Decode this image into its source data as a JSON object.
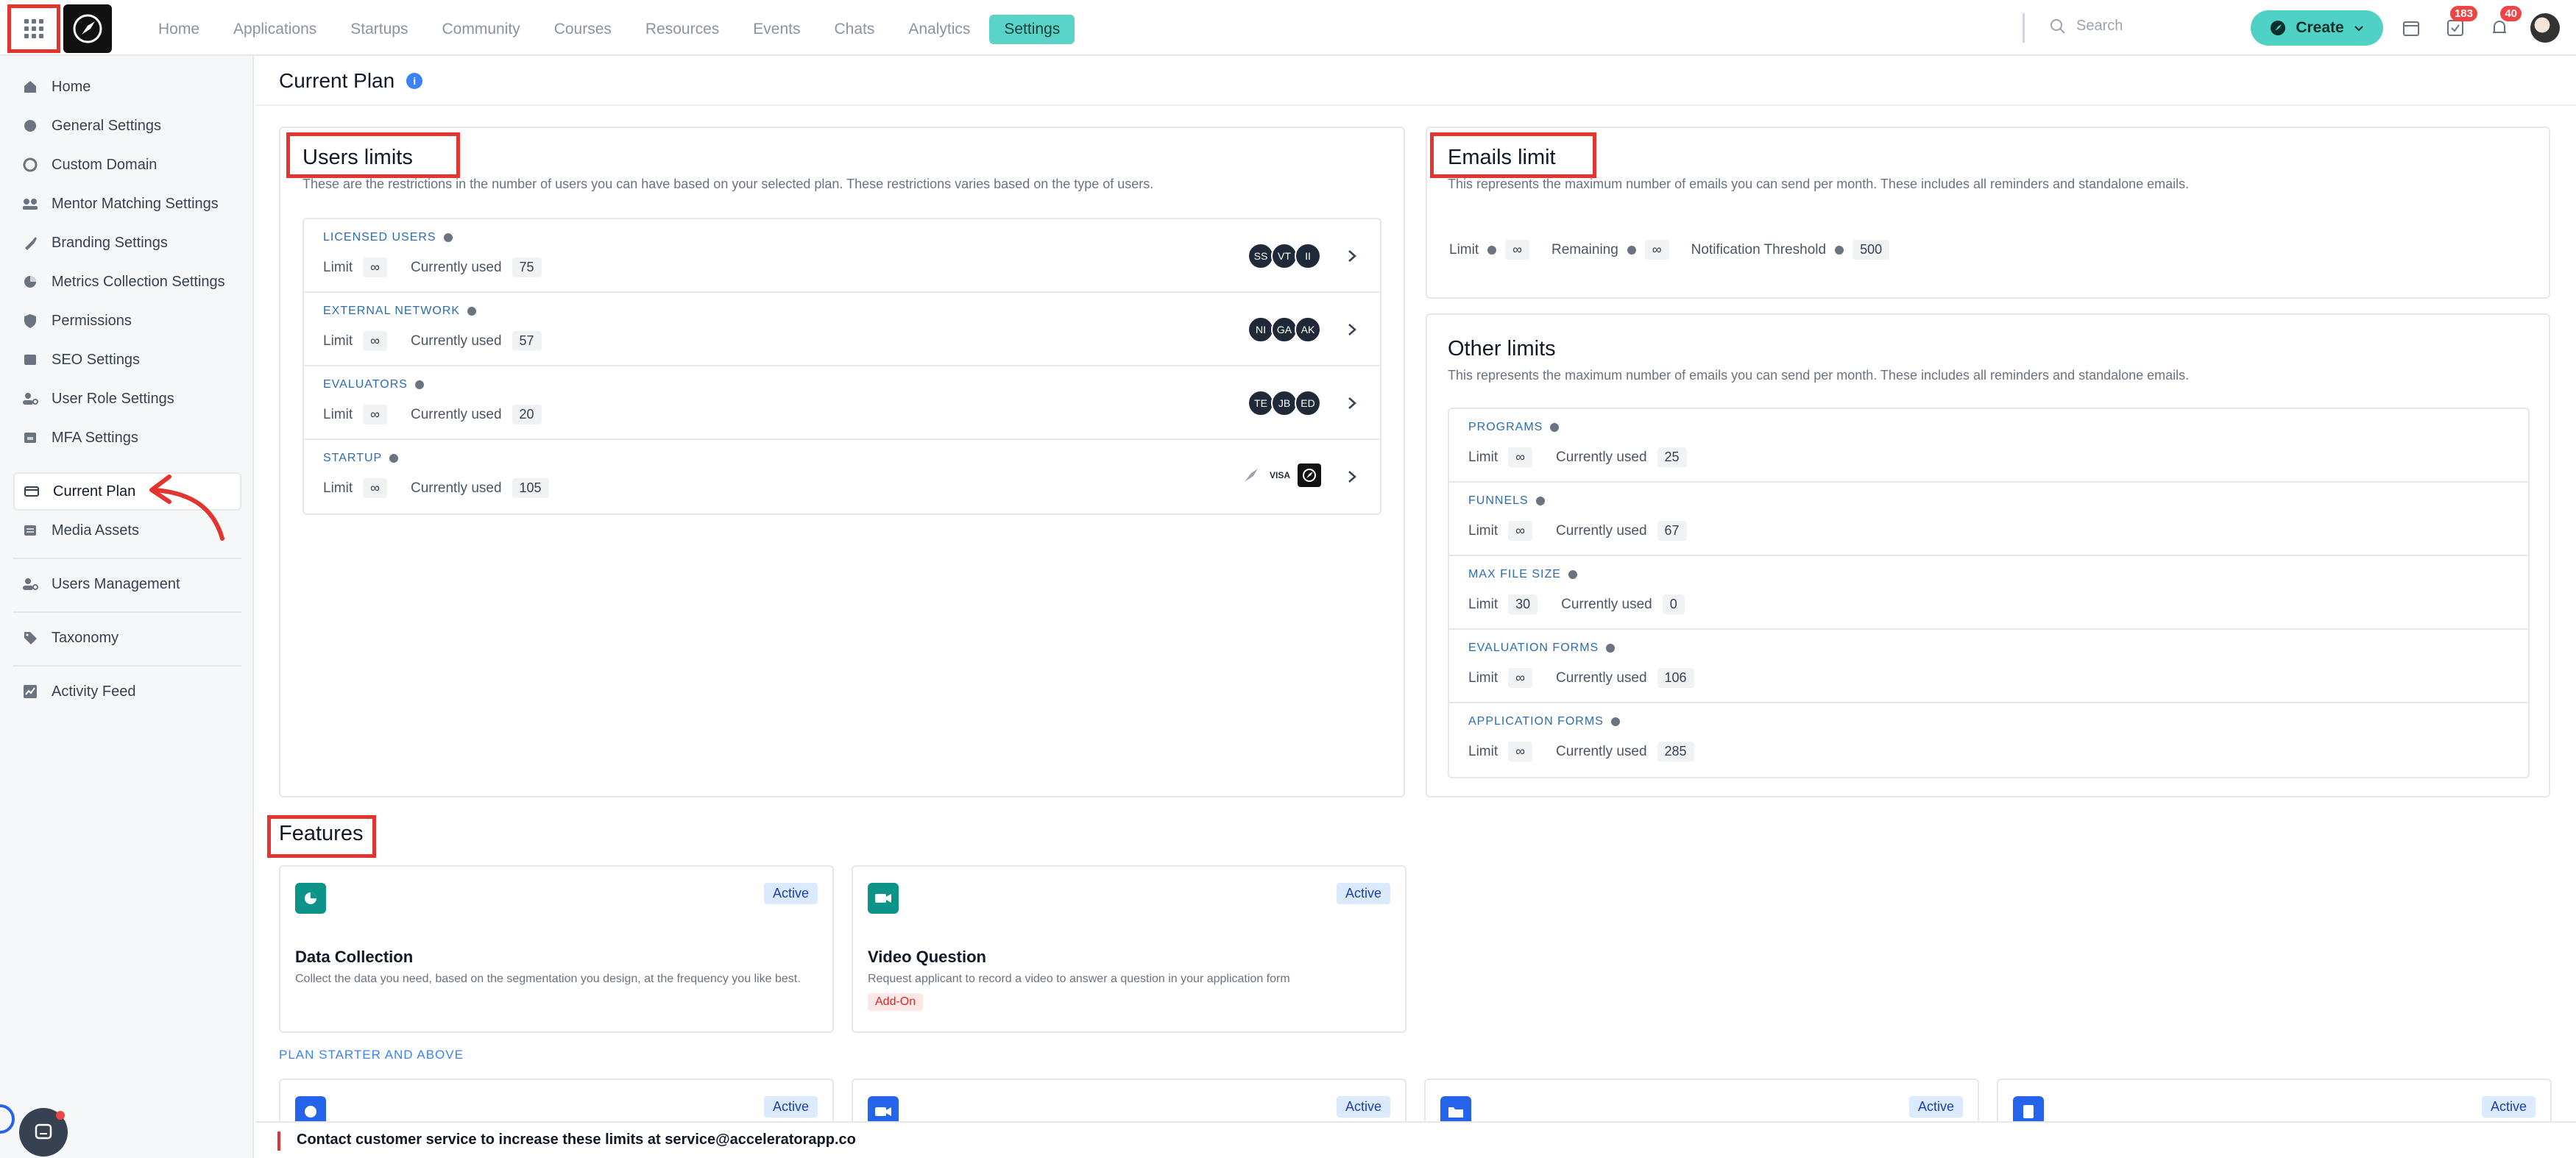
{
  "topbar": {
    "nav": [
      "Home",
      "Applications",
      "Startups",
      "Community",
      "Courses",
      "Resources",
      "Events",
      "Chats",
      "Analytics",
      "Settings"
    ],
    "active_nav": "Settings",
    "search_placeholder": "Search",
    "create_label": "Create",
    "tasks_badge": "183",
    "notifications_badge": "40",
    "accent": "#5ad4c8"
  },
  "sidebar": {
    "items": [
      "Home",
      "General Settings",
      "Custom Domain",
      "Mentor Matching Settings",
      "Branding Settings",
      "Metrics Collection Settings",
      "Permissions",
      "SEO Settings",
      "User Role Settings",
      "MFA Settings",
      "Current Plan",
      "Media Assets",
      "Users Management",
      "Taxonomy",
      "Activity Feed"
    ],
    "active": "Current Plan"
  },
  "page": {
    "title": "Current Plan",
    "info": "i"
  },
  "users_limits": {
    "title": "Users limits",
    "description": "These are the restrictions in the number of users you can have based on your selected plan. These restrictions varies based on the type of users.",
    "limit_label": "Limit",
    "used_label": "Currently used",
    "rows": [
      {
        "name": "LICENSED USERS",
        "limit": "∞",
        "used": "75",
        "avatars": [
          "SS",
          "VT",
          "II"
        ]
      },
      {
        "name": "EXTERNAL NETWORK",
        "limit": "∞",
        "used": "57",
        "avatars": [
          "NI",
          "GA",
          "AK"
        ]
      },
      {
        "name": "EVALUATORS",
        "limit": "∞",
        "used": "20",
        "avatars": [
          "TE",
          "JB",
          "ED"
        ]
      },
      {
        "name": "STARTUP",
        "limit": "∞",
        "used": "105",
        "avatars": []
      }
    ],
    "startup_logo_text": "VISA"
  },
  "emails_limit": {
    "title": "Emails limit",
    "description": "This represents the maximum number of emails you can send per month. These includes all reminders and standalone emails.",
    "limit_label": "Limit",
    "limit": "∞",
    "remaining_label": "Remaining",
    "remaining": "∞",
    "threshold_label": "Notification Threshold",
    "threshold": "500"
  },
  "other_limits": {
    "title": "Other limits",
    "description": "This represents the maximum number of emails you can send per month. These includes all reminders and standalone emails.",
    "limit_label": "Limit",
    "used_label": "Currently used",
    "rows": [
      {
        "name": "PROGRAMS",
        "limit": "∞",
        "used": "25"
      },
      {
        "name": "FUNNELS",
        "limit": "∞",
        "used": "67"
      },
      {
        "name": "MAX FILE SIZE",
        "limit": "30",
        "used": "0"
      },
      {
        "name": "EVALUATION FORMS",
        "limit": "∞",
        "used": "106"
      },
      {
        "name": "APPLICATION FORMS",
        "limit": "∞",
        "used": "285"
      }
    ]
  },
  "features": {
    "title": "Features",
    "active_label": "Active",
    "cards": [
      {
        "title": "Data Collection",
        "description": "Collect the data you need, based on the segmentation you design, at the frequency you like best.",
        "color": "#0d9488"
      },
      {
        "title": "Video Question",
        "description": "Request applicant to record a video to answer a question in your application form",
        "addon": "Add-On",
        "color": "#0d9488"
      }
    ],
    "plan_label": "PLAN STARTER AND ABOVE"
  },
  "footer": {
    "text": "Contact customer service to increase these limits at service@acceleratorapp.co"
  }
}
